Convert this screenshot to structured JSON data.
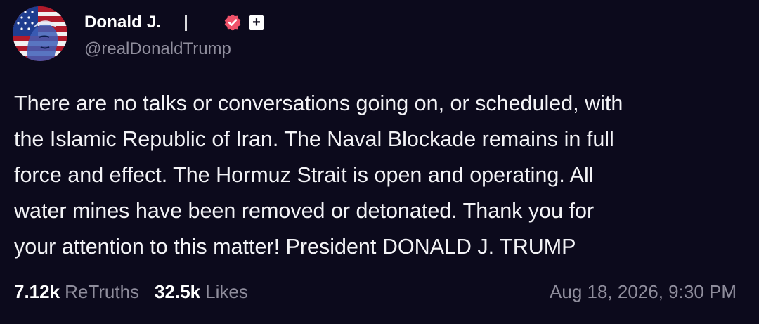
{
  "author": {
    "display_name": "Donald J.",
    "handle": "@realDonaldTrump",
    "add_label": "+"
  },
  "post": {
    "lines": [
      "There are no talks or conversations going on, or scheduled, with",
      "the Islamic Republic of Iran. The Naval Blockade remains in full",
      "force and effect. The Hormuz Strait is open and operating. All",
      "water mines have been removed or detonated. Thank you for",
      "your attention to this matter! President DONALD J. TRUMP"
    ]
  },
  "stats": {
    "retruths_count": "7.12k",
    "retruths_label": "ReTruths",
    "likes_count": "32.5k",
    "likes_label": "Likes"
  },
  "timestamp": "Aug 18, 2026, 9:30 PM",
  "colors": {
    "background": "#0c0a1c",
    "verified_badge": "#f0526a",
    "muted_text": "#8f8d9c"
  }
}
